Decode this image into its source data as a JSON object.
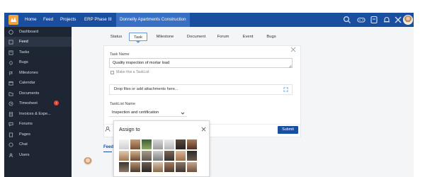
{
  "topbar": {
    "items": [
      {
        "label": "Home"
      },
      {
        "label": "Feed"
      },
      {
        "label": "Projects"
      },
      {
        "label": "ERP Phase III"
      },
      {
        "label": "Donnelly Apartments Construction"
      }
    ],
    "icons": [
      "search-icon",
      "gamepad-icon",
      "bookmark-icon",
      "bell-icon",
      "settings-icon"
    ],
    "colors": {
      "bar": "#1a4fa0",
      "active": "#3a70c4"
    }
  },
  "sidebar": {
    "items": [
      {
        "label": "Dashboard",
        "icon": "dashboard-icon"
      },
      {
        "label": "Feed",
        "icon": "feed-icon"
      },
      {
        "label": "Tasks",
        "icon": "tasks-icon"
      },
      {
        "label": "Bugs",
        "icon": "bug-icon"
      },
      {
        "label": "Milestones",
        "icon": "milestone-icon"
      },
      {
        "label": "Calendar",
        "icon": "calendar-icon"
      },
      {
        "label": "Documents",
        "icon": "documents-icon"
      },
      {
        "label": "Timesheet",
        "icon": "timesheet-icon",
        "badge": "!"
      },
      {
        "label": "Invoices & Expe...",
        "icon": "invoice-icon"
      },
      {
        "label": "Forums",
        "icon": "forums-icon"
      },
      {
        "label": "Pages",
        "icon": "pages-icon"
      },
      {
        "label": "Chat",
        "icon": "chat-icon"
      },
      {
        "label": "Users",
        "icon": "users-icon"
      }
    ],
    "active": "Feed"
  },
  "tabs": [
    {
      "label": "Status"
    },
    {
      "label": "Task"
    },
    {
      "label": "Milestone"
    },
    {
      "label": "Document"
    },
    {
      "label": "Forum"
    },
    {
      "label": "Event"
    },
    {
      "label": "Bugs"
    }
  ],
  "form": {
    "task_name_label": "Task Name",
    "task_name_value": "Quality inspection of mortar load",
    "tasklist_checkbox_label": "Make this a TaskList",
    "attachments_placeholder": "Drop files or add attachments here...",
    "tasklist_name_label": "TaskList Name",
    "tasklist_name_value": "Inspection and certification",
    "submit_label": "Submit"
  },
  "assign_popup": {
    "title": "Assign to"
  },
  "feed_section": {
    "label": "Feed"
  }
}
